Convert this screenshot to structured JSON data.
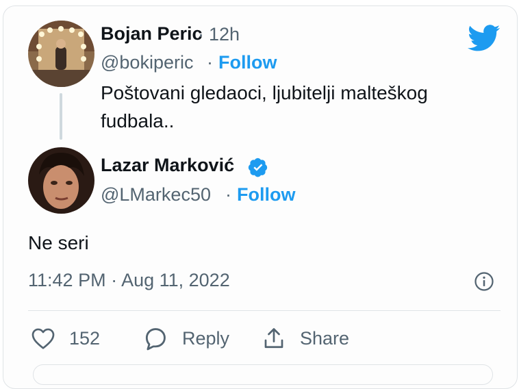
{
  "colors": {
    "accent": "#1d9bf0",
    "muted": "#536471",
    "text": "#0f1419"
  },
  "quoted_tweet": {
    "author_name": "Bojan Peric",
    "separator": "·",
    "age": "12h",
    "handle": "@bokiperic",
    "follow_label": "Follow",
    "text": "Poštovani gledaoci, ljubitelji malteškog fudbala.."
  },
  "reply_tweet": {
    "author_name": "Lazar Marković",
    "verified_icon": "verified-badge-icon",
    "handle": "@LMarkec50",
    "follow_label": "Follow",
    "text": "Ne seri",
    "timestamp": "11:42 PM · Aug 11, 2022"
  },
  "actions": {
    "like_icon": "heart-icon",
    "like_count": "152",
    "reply_icon": "comment-icon",
    "reply_label": "Reply",
    "share_icon": "share-icon",
    "share_label": "Share"
  },
  "brand_icon": "twitter-bird-icon",
  "info_icon": "info-icon"
}
